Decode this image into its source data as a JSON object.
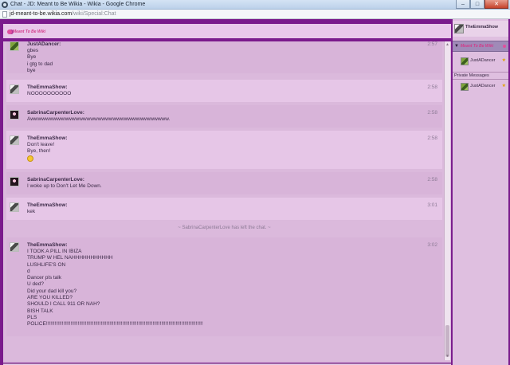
{
  "window": {
    "title": "Chat - JD: Meant to Be Wikia - Wikia - Google Chrome",
    "url_host": "jd-meant-to-be.wikia.com",
    "url_path": "/wiki/Special:Chat",
    "minimize": "–",
    "maximize": "□",
    "close": "✕"
  },
  "wiki": {
    "logo_text": "Meant To Be Wiki"
  },
  "messages": [
    {
      "user": "JustADancer:",
      "time": "2:57",
      "lines": [
        "gbes",
        "Bye",
        "i gtg to dad",
        "bye"
      ]
    },
    {
      "user": "TheEmmaShow:",
      "time": "2:58",
      "lines": [
        "NOOOOOOOOOO"
      ]
    },
    {
      "user": "SabrinaCarpenterLove:",
      "time": "2:58",
      "lines": [
        "Awwwwwwwwwwwwwwwwwwwwwwwwwwwwwwwwwwwww."
      ]
    },
    {
      "user": "TheEmmaShow:",
      "time": "2:58",
      "lines": [
        "Don't leave!",
        "Bye, then!"
      ]
    },
    {
      "user": "SabrinaCarpenterLove:",
      "time": "2:58",
      "lines": [
        "I woke up to Don't Let Me Down."
      ]
    },
    {
      "user": "TheEmmaShow:",
      "time": "3:01",
      "lines": [
        "kek"
      ]
    },
    {
      "user": "TheEmmaShow:",
      "time": "3:02",
      "lines": [
        "I TOOK A PILL IN IBIZA",
        "TRUMP W HEL NAHHHHHHHHHHH",
        "LUSHLIFE'S ON",
        "d",
        "Dancer pls talk",
        "U ded?",
        "Did your dad kill you?",
        "ARE YOU KILLED?",
        "SHOULD I CALL 911 OR NAH?",
        "BISH TALK",
        "PLS",
        "POLICE!!!!!!!!!!!!!!!!!!!!!!!!!!!!!!!!!!!!!!!!!!!!!!!!!!!!!!!!!!!!!!!!!!!!!!!!!!!!!!!!!!!!!!!!!!!!!!!!!!!!!!!!!!!!!"
      ]
    }
  ],
  "system_message": "~ SabrinaCarpenterLove has left the chat. ~",
  "composer": {
    "value": "|"
  },
  "sidebar": {
    "me": "TheEmmaShow",
    "room_logo": "Meant To Be Wiki",
    "room_user": "JustADancer",
    "pm_header": "Private Messages",
    "pm_user": "JustADancer"
  },
  "colors": {
    "frame": "#7a1a8c",
    "chat_bg": "#dbb9dc",
    "message_bg": "#e6c6e7",
    "message_alt_bg": "#d8b4d9",
    "room_highlight": "#a08ab8"
  }
}
